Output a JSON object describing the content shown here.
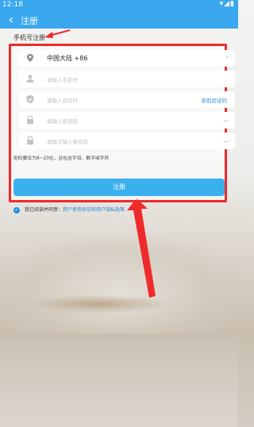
{
  "status_bar": {
    "time": "12:18",
    "icons_text": "▾◢▮"
  },
  "header": {
    "title": "注册"
  },
  "section_label": "手机号注册",
  "form": {
    "country": "中国大陆 +86",
    "phone_placeholder": "请输入手机号",
    "code_placeholder": "请输入验证码",
    "get_code_label": "获取验证码",
    "password_placeholder": "请输入新密码",
    "confirm_placeholder": "请再次输入新密码",
    "password_hint": "密码要设为8~20位，且包含字母、数字或字符"
  },
  "register_button_label": "注册",
  "agreement": {
    "prefix": "我已阅读并同意：",
    "link_text": "用户使用协议和用户隐私政策"
  },
  "colors": {
    "brand_blue": "#3aa8ef",
    "annotation_red": "#ee2a2a"
  }
}
